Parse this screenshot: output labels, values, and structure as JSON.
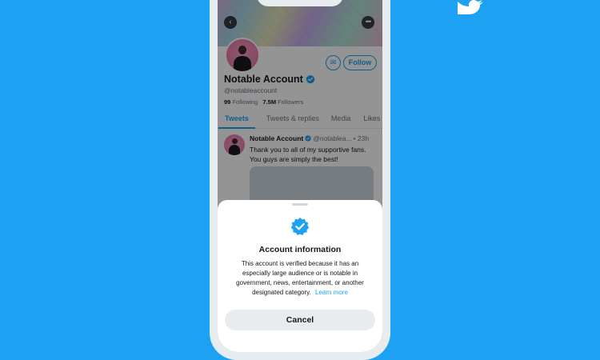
{
  "colors": {
    "background": "#1da1f2",
    "accent": "#1da1f2",
    "text_primary": "#14171a",
    "text_secondary": "#657786"
  },
  "brand": {
    "icon": "twitter-bird-icon"
  },
  "profile": {
    "name": "Notable Account",
    "handle": "@notableaccount",
    "following_count": "99",
    "following_label": "Following",
    "followers_count": "7.5M",
    "followers_label": "Followers",
    "follow_label": "Follow",
    "back_icon": "back-arrow-icon",
    "more_icon": "more-icon",
    "message_icon": "mail-icon",
    "verified_icon": "verified-badge-icon"
  },
  "tabs": [
    {
      "label": "Tweets",
      "active": true
    },
    {
      "label": "Tweets & replies",
      "active": false
    },
    {
      "label": "Media",
      "active": false
    },
    {
      "label": "Likes",
      "active": false
    }
  ],
  "tweet": {
    "name": "Notable Account",
    "handle": "@notablea...",
    "time": "• 23h",
    "text": "Thank you to all of my supportive fans. You guys are simply the best!"
  },
  "sheet": {
    "title": "Account information",
    "body": "This account is verified because it has an especially large audience or is notable in government, news, entertainment, or another designated category.",
    "link": "Learn more",
    "cancel_label": "Cancel"
  }
}
